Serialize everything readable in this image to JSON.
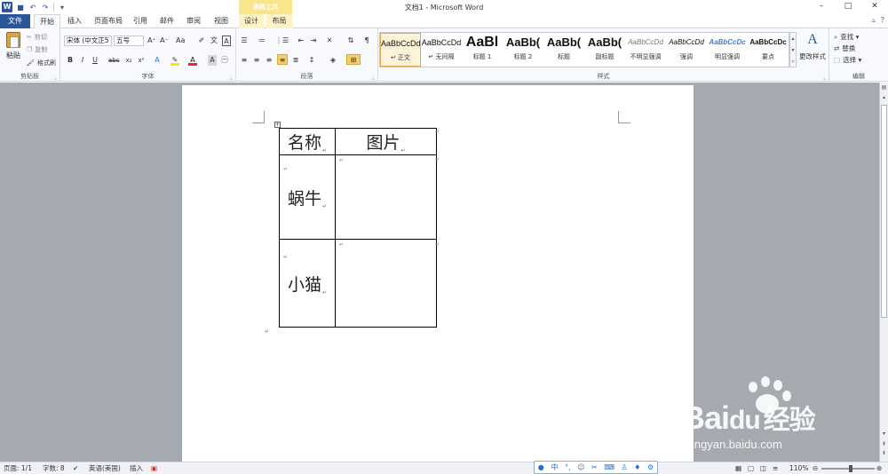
{
  "titlebar": {
    "title": "文档1 - Microsoft Word",
    "context_header": "表格工具",
    "logo": "W",
    "qat_icons": [
      "save-icon",
      "undo-icon",
      "redo-icon",
      "customize-icon"
    ],
    "min": "–",
    "max": "□",
    "close": "✕"
  },
  "tabs": [
    "文件",
    "开始",
    "插入",
    "页面布局",
    "引用",
    "邮件",
    "审阅",
    "视图",
    "设计",
    "布局"
  ],
  "ribbon": {
    "clipboard": {
      "label": "剪贴板",
      "paste": "粘贴",
      "cut": "剪切",
      "copy": "复制",
      "format_painter": "格式刷"
    },
    "font": {
      "label": "字体",
      "font_name": "宋体 (中文正5",
      "font_size": "五号",
      "bold": "B",
      "italic": "I",
      "underline": "U",
      "strike": "abc",
      "sub": "x₂",
      "sup": "x²",
      "grow": "A⁺",
      "shrink": "A⁻",
      "case": "Aa",
      "clear": "✐",
      "wen": "文",
      "A_box": "A"
    },
    "paragraph": {
      "label": "段落"
    },
    "styles": {
      "label": "样式",
      "items": [
        {
          "preview": "AaBbCcDd",
          "name": "↵ 正文",
          "size": 9,
          "bold": false,
          "color": "#111",
          "italic": false
        },
        {
          "preview": "AaBbCcDd",
          "name": "↵ 无间隔",
          "size": 9,
          "bold": false,
          "color": "#111",
          "italic": false
        },
        {
          "preview": "AaBl",
          "name": "标题 1",
          "size": 16,
          "bold": true,
          "color": "#111",
          "italic": false
        },
        {
          "preview": "AaBb(",
          "name": "标题 2",
          "size": 13,
          "bold": true,
          "color": "#111",
          "italic": false
        },
        {
          "preview": "AaBb(",
          "name": "标题",
          "size": 13,
          "bold": true,
          "color": "#111",
          "italic": false
        },
        {
          "preview": "AaBb(",
          "name": "副标题",
          "size": 13,
          "bold": true,
          "color": "#111",
          "italic": false
        },
        {
          "preview": "AaBbCcDd",
          "name": "不明显强调",
          "size": 8,
          "bold": false,
          "color": "#777",
          "italic": true
        },
        {
          "preview": "AaBbCcDd",
          "name": "强调",
          "size": 8,
          "bold": false,
          "color": "#111",
          "italic": true
        },
        {
          "preview": "AaBbCcDc",
          "name": "明显强调",
          "size": 8,
          "bold": true,
          "color": "#4a7ec4",
          "italic": true
        },
        {
          "preview": "AaBbCcDc",
          "name": "要点",
          "size": 8,
          "bold": true,
          "color": "#111",
          "italic": false
        }
      ],
      "change_styles": "更改样式"
    },
    "editing": {
      "label": "编辑",
      "find": "查找 ▾",
      "replace": "替换",
      "select": "选择 ▾"
    }
  },
  "document": {
    "table": {
      "header": [
        "名称",
        "图片"
      ],
      "rows": [
        [
          "蜗牛",
          ""
        ],
        [
          "小猫",
          ""
        ]
      ]
    }
  },
  "watermark": {
    "brand": "Bai",
    "brand2": "du",
    "cn": "经验",
    "sub": "jingyan.baidu.com"
  },
  "statusbar": {
    "page": "页面: 1/1",
    "words": "字数: 8",
    "language": "英语(美国)",
    "mode": "插入",
    "zoom": "110%",
    "ime_lang": "中"
  },
  "colors": {
    "accent": "#2b579a",
    "context_tab": "#fbe58a",
    "doc_bg": "#a5a9b0"
  }
}
